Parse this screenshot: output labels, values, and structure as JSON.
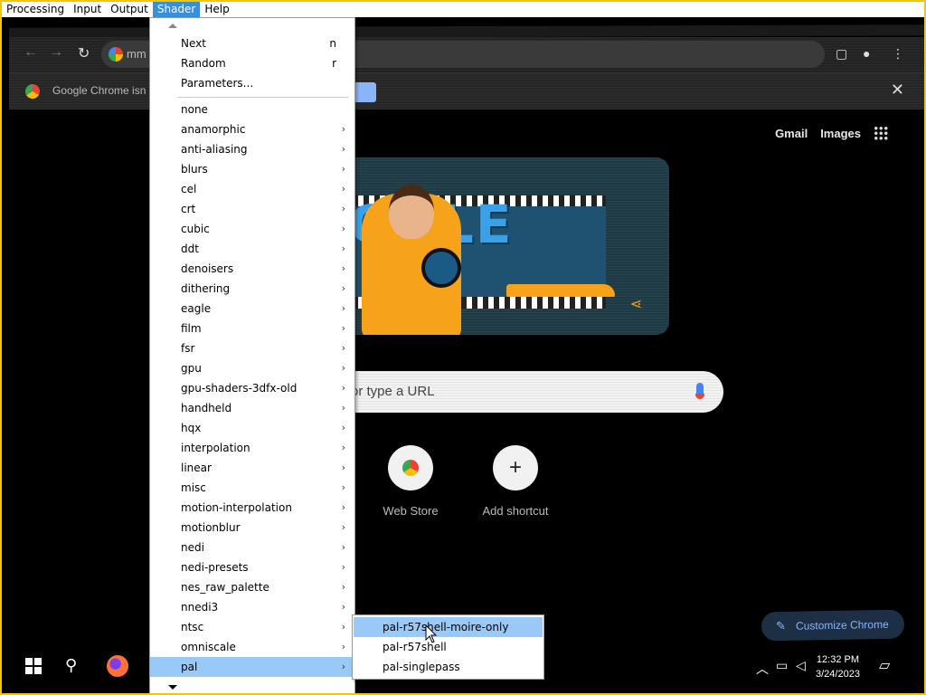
{
  "menubar": {
    "items": [
      "Processing",
      "Input",
      "Output",
      "Shader",
      "Help"
    ],
    "active": "Shader"
  },
  "shader_menu": {
    "top_items": [
      {
        "label": "Next",
        "shortcut": "n"
      },
      {
        "label": "Random",
        "shortcut": "r"
      },
      {
        "label": "Parameters..."
      }
    ],
    "items": [
      {
        "label": "none",
        "submenu": false
      },
      {
        "label": "anamorphic",
        "submenu": true
      },
      {
        "label": "anti-aliasing",
        "submenu": true
      },
      {
        "label": "blurs",
        "submenu": true
      },
      {
        "label": "cel",
        "submenu": true
      },
      {
        "label": "crt",
        "submenu": true
      },
      {
        "label": "cubic",
        "submenu": true
      },
      {
        "label": "ddt",
        "submenu": true
      },
      {
        "label": "denoisers",
        "submenu": true
      },
      {
        "label": "dithering",
        "submenu": true
      },
      {
        "label": "eagle",
        "submenu": true
      },
      {
        "label": "film",
        "submenu": true
      },
      {
        "label": "fsr",
        "submenu": true
      },
      {
        "label": "gpu",
        "submenu": true
      },
      {
        "label": "gpu-shaders-3dfx-old",
        "submenu": true
      },
      {
        "label": "handheld",
        "submenu": true
      },
      {
        "label": "hqx",
        "submenu": true
      },
      {
        "label": "interpolation",
        "submenu": true
      },
      {
        "label": "linear",
        "submenu": true
      },
      {
        "label": "misc",
        "submenu": true
      },
      {
        "label": "motion-interpolation",
        "submenu": true
      },
      {
        "label": "motionblur",
        "submenu": true
      },
      {
        "label": "nedi",
        "submenu": true
      },
      {
        "label": "nedi-presets",
        "submenu": true
      },
      {
        "label": "nes_raw_palette",
        "submenu": true
      },
      {
        "label": "nnedi3",
        "submenu": true
      },
      {
        "label": "ntsc",
        "submenu": true
      },
      {
        "label": "omniscale",
        "submenu": true
      },
      {
        "label": "pal",
        "submenu": true,
        "highlighted": true
      }
    ],
    "arrow_glyph": "›"
  },
  "pal_submenu": {
    "items": [
      {
        "label": "pal-r57shell-moire-only",
        "highlighted": true
      },
      {
        "label": "pal-r57shell"
      },
      {
        "label": "pal-singlepass"
      }
    ]
  },
  "browser": {
    "omnibox_text": "mm",
    "infobar_message": "Google Chrome isn",
    "header_links": [
      "Gmail",
      "Images"
    ],
    "doodle_text": "OGLE",
    "search_placeholder": "or type a URL",
    "shortcuts": [
      {
        "label": "Web Store",
        "icon": "chrome-web-store-icon"
      },
      {
        "label": "Add shortcut",
        "icon": "plus-icon",
        "glyph": "+"
      }
    ],
    "customize_label": "Customize Chrome"
  },
  "taskbar": {
    "time": "12:32 PM",
    "date": "3/24/2023"
  },
  "colors": {
    "menu_highlight": "#99c9f6",
    "menubar_active": "#3b8fd8",
    "frame": "#f0c800"
  }
}
